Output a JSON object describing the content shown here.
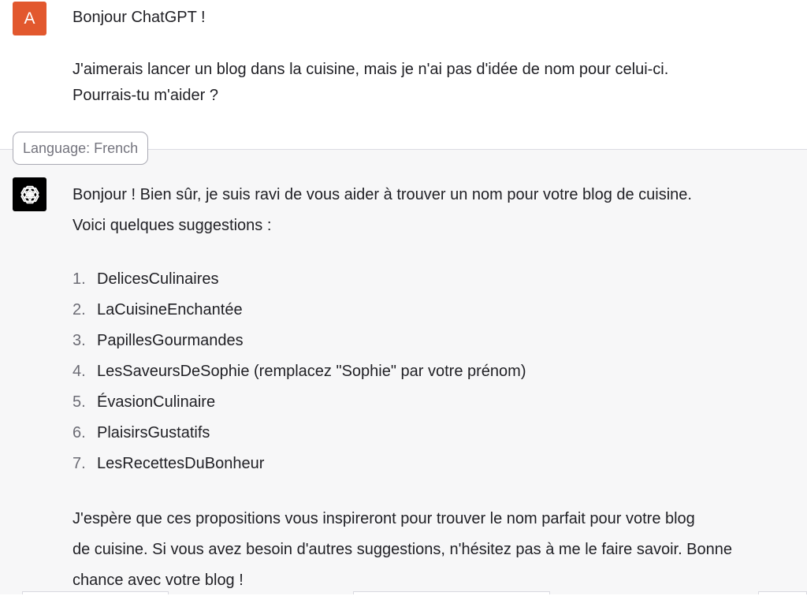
{
  "colors": {
    "user_avatar_bg": "#e2582e",
    "assistant_avatar_bg": "#000000",
    "assistant_area_bg": "#f7f7f8"
  },
  "user_message": {
    "avatar_letter": "A",
    "greeting": "Bonjour ChatGPT !",
    "line1": "J'aimerais lancer un blog dans la cuisine, mais je n'ai pas d'idée de nom pour celui-ci.",
    "line2": "Pourrais-tu m'aider ?"
  },
  "language_tag": "Language: French",
  "assistant_message": {
    "avatar_icon": "openai-logo-icon",
    "intro1": "Bonjour ! Bien sûr, je suis ravi de vous aider à trouver un nom pour votre blog de cuisine.",
    "intro2": "Voici quelques suggestions :",
    "suggestions": [
      {
        "number": "1.",
        "text": "DelicesCulinaires"
      },
      {
        "number": "2.",
        "text": "LaCuisineEnchantée"
      },
      {
        "number": "3.",
        "text": "PapillesGourmandes"
      },
      {
        "number": "4.",
        "text": "LesSaveursDeSophie (remplacez \"Sophie\" par votre prénom)"
      },
      {
        "number": "5.",
        "text": "ÉvasionCulinaire"
      },
      {
        "number": "6.",
        "text": "PlaisirsGustatifs"
      },
      {
        "number": "7.",
        "text": "LesRecettesDuBonheur"
      }
    ],
    "outro1": "J'espère que ces propositions vous inspireront pour trouver le nom parfait pour votre blog",
    "outro2": "de cuisine. Si vous avez besoin d'autres suggestions, n'hésitez pas à me le faire savoir. Bonne",
    "outro3": "chance avec votre blog !"
  }
}
